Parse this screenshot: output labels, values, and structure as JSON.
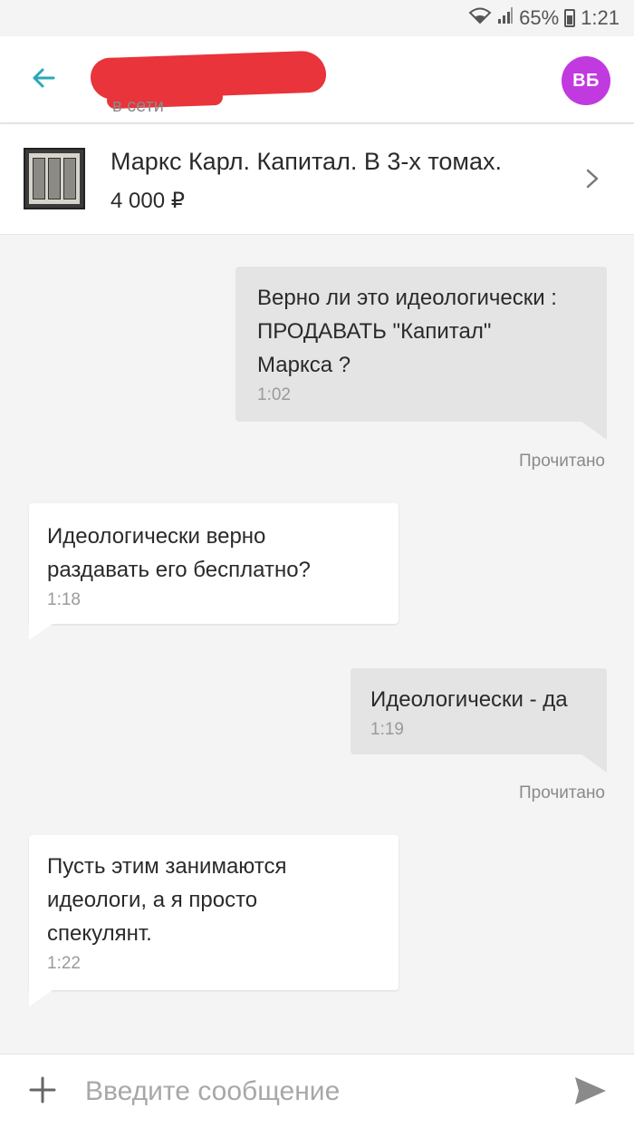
{
  "status_bar": {
    "battery": "65%",
    "time": "1:21"
  },
  "header": {
    "back_icon": "arrow-left-icon",
    "contact_status": "в сети",
    "avatar_initials": "ВБ",
    "avatar_color": "#c13ae0",
    "accent_color": "#2aa7b8"
  },
  "product": {
    "title": "Маркс Карл. Капитал. В 3-х томах.",
    "price": "4 000 ₽",
    "chevron_icon": "chevron-right-icon"
  },
  "messages": [
    {
      "direction": "outgoing",
      "text": "Верно ли это идеологически :\nПРОДАВАТЬ \"Капитал\"\nМаркса ?",
      "time": "1:02",
      "status": "Прочитано"
    },
    {
      "direction": "incoming",
      "text": "Идеологически верно\nраздавать его бесплатно?",
      "time": "1:18"
    },
    {
      "direction": "outgoing",
      "text": "Идеологически - да",
      "time": "1:19",
      "status": "Прочитано"
    },
    {
      "direction": "incoming",
      "text": "Пусть этим занимаются\nидеологи, а я просто\nспекулянт.",
      "time": "1:22"
    }
  ],
  "composer": {
    "placeholder": "Введите сообщение",
    "value": "",
    "plus_icon": "plus-icon",
    "send_icon": "send-icon"
  }
}
